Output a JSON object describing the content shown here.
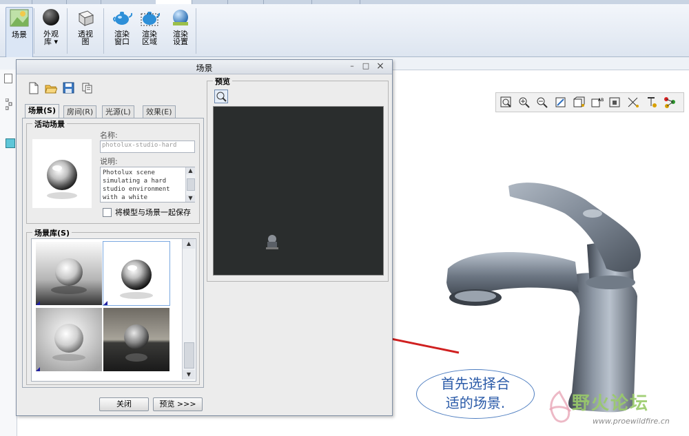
{
  "ribbon": {
    "buttons": [
      {
        "label_line1": "场景",
        "label_line2": "",
        "icon": "scene-icon",
        "selected": true
      },
      {
        "label_line1": "外观",
        "label_line2": "库 ▾",
        "icon": "appearance-sphere-icon",
        "selected": false
      },
      {
        "label_line1": "透视",
        "label_line2": "图",
        "icon": "perspective-cube-icon",
        "selected": false
      },
      {
        "label_line1": "渲染",
        "label_line2": "窗口",
        "icon": "teapot-icon",
        "selected": false
      },
      {
        "label_line1": "渲染",
        "label_line2": "区域",
        "icon": "teapot-region-icon",
        "selected": false
      },
      {
        "label_line1": "渲染",
        "label_line2": "设置",
        "icon": "render-settings-icon",
        "selected": false
      }
    ]
  },
  "dialog": {
    "title": "场景",
    "controls": {
      "minimize": "–",
      "restore": "□",
      "close": "×"
    },
    "tabs": [
      {
        "label": "场景(S)",
        "active": true
      },
      {
        "label": "房间(R)",
        "active": false
      },
      {
        "label": "光源(L)",
        "active": false
      },
      {
        "label": "效果(E)",
        "active": false
      }
    ],
    "active_scene": {
      "group_label": "活动场景",
      "name_label": "名称:",
      "name_value": "photolux-studio-hard",
      "desc_label": "说明:",
      "desc_lines": [
        "Photolux scene",
        "simulating a hard",
        "studio environment",
        "with a white"
      ],
      "save_checkbox_label": "将模型与场景一起保存",
      "save_checked": false
    },
    "library": {
      "group_label": "场景库(S)"
    },
    "preview": {
      "group_label": "预览"
    },
    "buttons": {
      "close": "关闭",
      "preview": "预览 >>>"
    }
  },
  "annotation": {
    "line1": "首先选择合",
    "line2": "适的场景.",
    "color": "#2a5aa8"
  },
  "watermark": {
    "title": "野火论坛",
    "url": "www.proewildfire.cn"
  },
  "colors": {
    "accent_line": "#d02020",
    "preview_bg": "#2a2d2d"
  }
}
